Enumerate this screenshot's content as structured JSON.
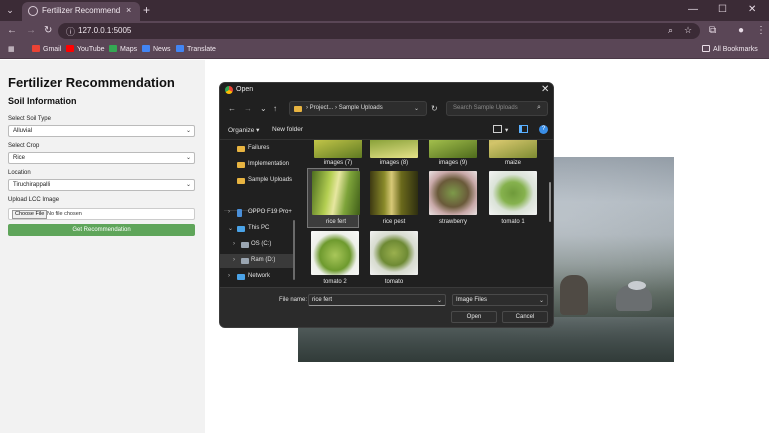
{
  "browser": {
    "tab_title": "Fertilizer Recommendation Sys",
    "tab_close": "×",
    "new_tab": "+",
    "tab_menu": "⌄",
    "url": "127.0.0.1:5005",
    "window_controls": [
      "—",
      "☐",
      "✕"
    ],
    "bookmarks": [
      {
        "label": "Gmail",
        "color": "#ea4335"
      },
      {
        "label": "YouTube",
        "color": "#ff0000"
      },
      {
        "label": "Maps",
        "color": "#34a853"
      },
      {
        "label": "News",
        "color": "#4285f4"
      },
      {
        "label": "Translate",
        "color": "#4285f4"
      }
    ],
    "all_bookmarks": "All Bookmarks"
  },
  "page": {
    "title": "Fertilizer Recommendation",
    "section": "Soil Information",
    "soil_label": "Select Soil Type",
    "soil_value": "Alluvial",
    "crop_label": "Select Crop",
    "crop_value": "Rice",
    "location_label": "Location",
    "location_value": "Tiruchirappalli",
    "upload_label": "Upload LCC Image",
    "choose_file": "Choose File",
    "no_file": "No file chosen",
    "submit": "Get Recommendation"
  },
  "dialog": {
    "title": "Open",
    "close": "✕",
    "path": [
      "Project...",
      "Sample Uploads"
    ],
    "search_placeholder": "Search Sample Uploads",
    "organize": "Organize ▾",
    "new_folder": "New folder",
    "help": "?",
    "nav_items": [
      {
        "label": "Failures",
        "type": "folder"
      },
      {
        "label": "Implementation",
        "type": "folder"
      },
      {
        "label": "Sample Uploads",
        "type": "folder"
      },
      {
        "label": "OPPO F19 Pro+",
        "type": "device"
      },
      {
        "label": "This PC",
        "type": "pc"
      },
      {
        "label": "OS (C:)",
        "type": "drive"
      },
      {
        "label": "Ram (D:)",
        "type": "drive"
      },
      {
        "label": "Network",
        "type": "network"
      }
    ],
    "files": [
      {
        "name": "images (7)"
      },
      {
        "name": "images (8)"
      },
      {
        "name": "images (9)"
      },
      {
        "name": "maize"
      },
      {
        "name": "rice fert"
      },
      {
        "name": "rice pest"
      },
      {
        "name": "strawberry"
      },
      {
        "name": "tomato 1"
      },
      {
        "name": "tomato 2"
      },
      {
        "name": "tomato"
      }
    ],
    "file_name_label": "File name:",
    "file_name_value": "rice fert",
    "file_type": "Image Files",
    "open": "Open",
    "cancel": "Cancel"
  }
}
